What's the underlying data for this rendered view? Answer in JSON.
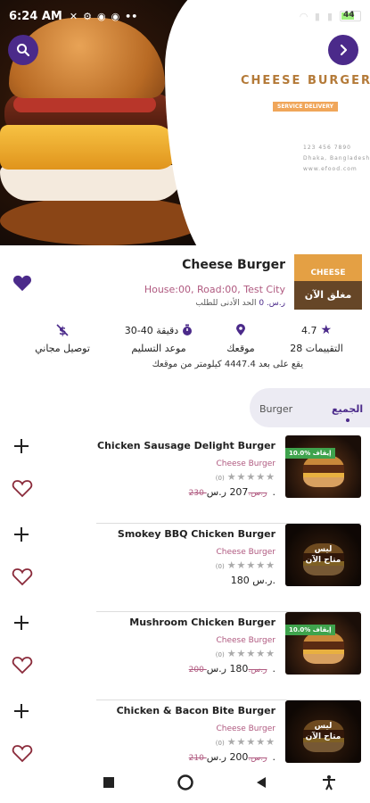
{
  "status_bar": {
    "time": "6:24 AM",
    "battery": "44"
  },
  "hero": {
    "brand": "CHEESE BURGER",
    "delivery": "SERVICE DELIVERY",
    "phone": "123 456 7890",
    "city": "Dhaka, Bangladesh",
    "site": "www.efood.com"
  },
  "restaurant": {
    "name": "Cheese Burger",
    "address": "House:00, Road:00, Test City",
    "min_order_label": "الحد الأدنى للطلب",
    "min_order_value": "ر.س. 0",
    "logo_text": "CHEESE",
    "closed_label": "مغلق الآن",
    "favorited": true
  },
  "stats": {
    "rating_value": "4.7",
    "rating_label": "28 التقييمات",
    "location_label": "موقعك",
    "time_value": "30-40 دقيقة",
    "time_label": "موعد التسليم",
    "free_delivery_label": "توصيل مجاني",
    "distance": "يقع على بعد 4447.4 كيلومتر من موقعك"
  },
  "tabs": [
    {
      "label": "الجميع",
      "active": true
    },
    {
      "label": "Burger",
      "active": false
    }
  ],
  "items": [
    {
      "name": "Chicken Sausage Delight Burger",
      "category": "Cheese Burger",
      "reviews": "(0)",
      "price": "207 ر.س.",
      "old_price": "230 ر.س.",
      "badge": "10.0% إيقاف",
      "closed": ""
    },
    {
      "name": "Smokey BBQ Chicken Burger",
      "category": "Cheese Burger",
      "reviews": "(0)",
      "price": "180 ر.س.",
      "old_price": "",
      "badge": "",
      "closed": "ليس متاح الآن"
    },
    {
      "name": "Mushroom Chicken Burger",
      "category": "Cheese Burger",
      "reviews": "(0)",
      "price": "180 ر.س.",
      "old_price": "200 ر.س.",
      "badge": "10.0% إيقاف",
      "closed": ""
    },
    {
      "name": "Chicken & Bacon Bite Burger",
      "category": "Cheese Burger",
      "reviews": "(0)",
      "price": "200 ر.س.",
      "old_price": "210 ر.س.",
      "badge": "",
      "closed": "ليس متاح الآن"
    }
  ],
  "colors": {
    "primary": "#4b2a8a",
    "accent": "#b05a80",
    "discount": "#3fa34d",
    "brand": "#b47a38"
  }
}
